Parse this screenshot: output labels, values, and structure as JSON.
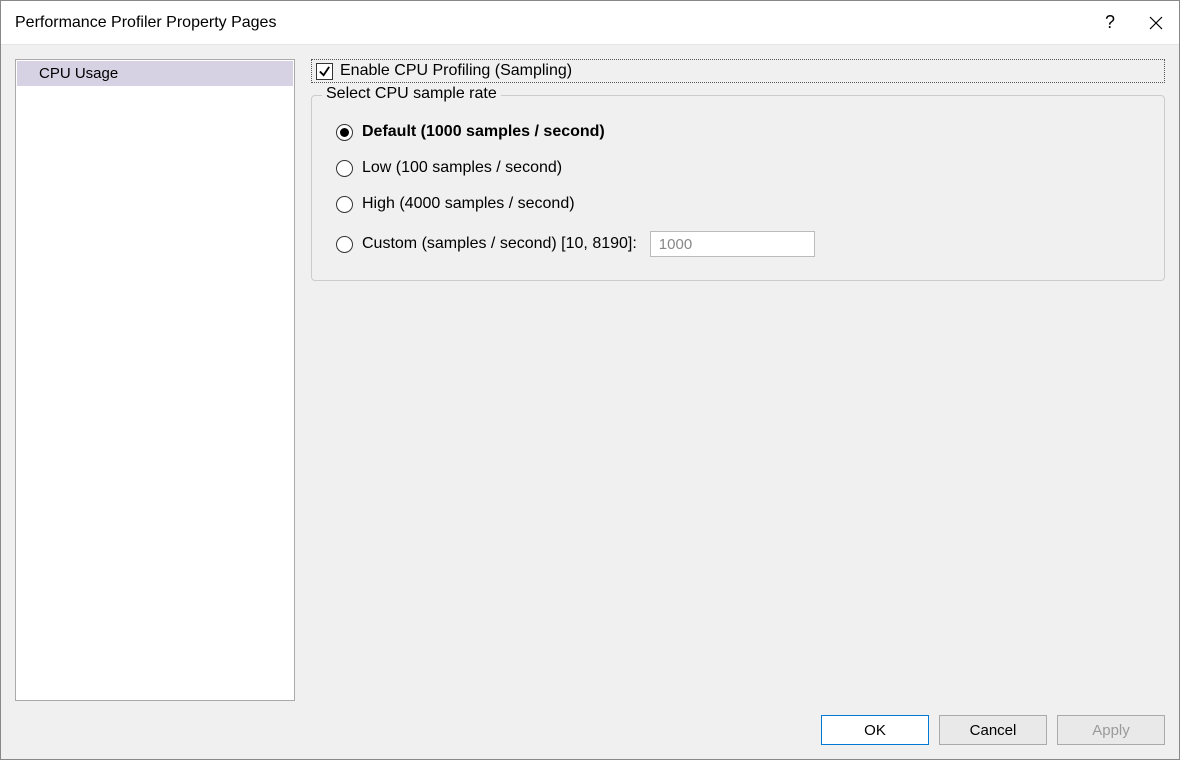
{
  "window": {
    "title": "Performance Profiler Property Pages"
  },
  "sidebar": {
    "items": [
      {
        "label": "CPU Usage",
        "selected": true
      }
    ]
  },
  "content": {
    "enable_checkbox": {
      "label": "Enable CPU Profiling (Sampling)",
      "checked": true
    },
    "groupbox": {
      "legend": "Select CPU sample rate",
      "options": [
        {
          "label": "Default (1000 samples / second)",
          "selected": true
        },
        {
          "label": "Low (100 samples / second)",
          "selected": false
        },
        {
          "label": "High (4000 samples / second)",
          "selected": false
        },
        {
          "label": "Custom (samples / second) [10, 8190]:",
          "selected": false
        }
      ],
      "custom_input_value": "1000"
    }
  },
  "buttons": {
    "ok": "OK",
    "cancel": "Cancel",
    "apply": "Apply"
  }
}
